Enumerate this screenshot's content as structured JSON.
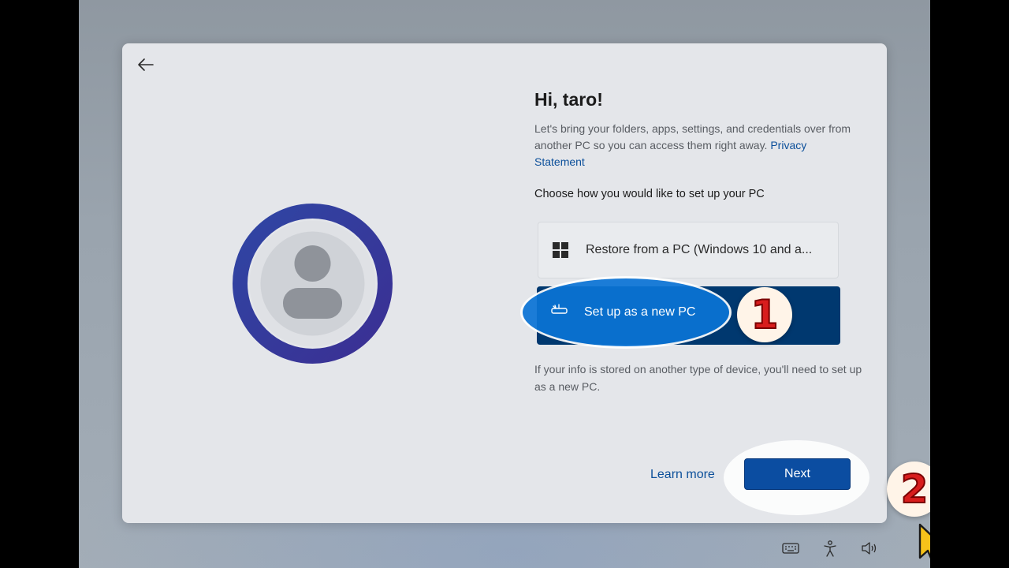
{
  "dialog": {
    "greeting": "Hi, taro!",
    "description_text": "Let's bring your folders, apps, settings, and credentials over from another PC so you can access them right away.",
    "privacy_link": "Privacy Statement",
    "choose_prompt": "Choose how you would like to set up your PC",
    "options": [
      {
        "label": "Restore from a PC (Windows 10 and a...",
        "icon": "windows-logo-icon"
      },
      {
        "label": "Set up as a new PC",
        "icon": "new-pc-icon",
        "selected": true
      }
    ],
    "note": "If your info is stored on another type of device, you'll need to set up as a new PC.",
    "learn_more": "Learn more",
    "next": "Next"
  },
  "annotations": {
    "step1": "1",
    "step2": "2"
  },
  "taskbar": {
    "icons": [
      "keyboard-icon",
      "accessibility-icon",
      "volume-icon"
    ]
  },
  "colors": {
    "accent": "#00386f",
    "next_button": "#0b4da1",
    "highlight": "#0a74d6",
    "badge_text": "#d81d1d"
  }
}
